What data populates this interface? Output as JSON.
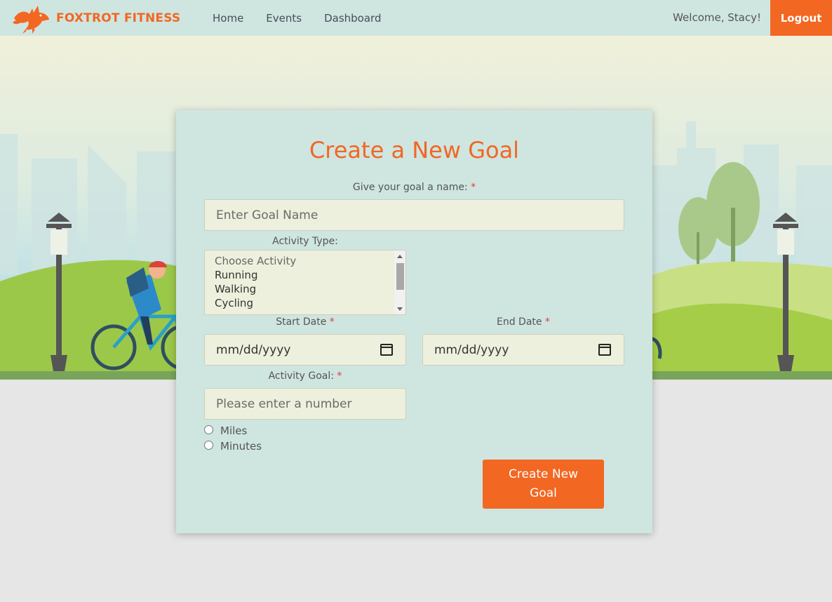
{
  "brand": {
    "name": "FOXTROT FITNESS",
    "logo_icon": "fox-logo-icon",
    "color": "#f26722"
  },
  "nav": {
    "links": [
      "Home",
      "Events",
      "Dashboard"
    ],
    "welcome": "Welcome, Stacy!",
    "logout": "Logout"
  },
  "form": {
    "title": "Create a New Goal",
    "goal_name_label": "Give your goal a name:",
    "goal_name_placeholder": "Enter Goal Name",
    "activity_type_label": "Activity Type:",
    "activity_options": [
      "Choose Activity",
      "Running",
      "Walking",
      "Cycling"
    ],
    "start_date_label": "Start Date",
    "end_date_label": "End Date",
    "date_placeholder": "mm/dd/yyyy",
    "activity_goal_label": "Activity Goal:",
    "activity_goal_placeholder": "Please enter a number",
    "units": [
      "Miles",
      "Minutes"
    ],
    "submit": "Create New Goal",
    "required_marker": "*"
  },
  "colors": {
    "accent": "#f26722",
    "nav_bg": "#cfe5e0",
    "card_bg": "#cfe5e0",
    "input_bg": "#edf0dc",
    "page_bg": "#e6e6e6"
  }
}
